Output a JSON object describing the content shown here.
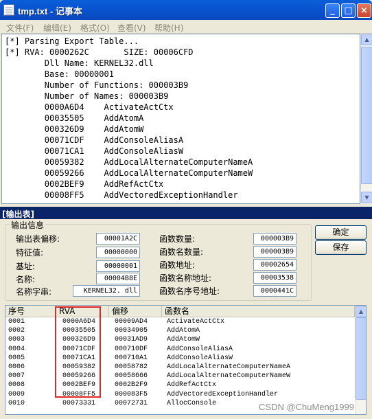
{
  "notepad": {
    "title": "tmp.txt - 记事本",
    "menu": [
      "文件(F)",
      "编辑(E)",
      "格式(O)",
      "查看(V)",
      "帮助(H)"
    ],
    "lines": [
      "[*] Parsing Export Table...",
      "[*] RVA: 0000262C       SIZE: 00006CFD",
      "        Dll Name: KERNEL32.dll",
      "        Base: 00000001",
      "        Number of Functions: 000003B9",
      "        Number of Names: 000003B9",
      "        0000A6D4    ActivateActCtx",
      "        00035505    AddAtomA",
      "        000326D9    AddAtomW",
      "        00071CDF    AddConsoleAliasA",
      "        00071CA1    AddConsoleAliasW",
      "        00059382    AddLocalAlternateComputerNameA",
      "        00059266    AddLocalAlternateComputerNameW",
      "        0002BEF9    AddRefActCtx",
      "        00008FF5    AddVectoredExceptionHandler"
    ]
  },
  "output": {
    "title": "[输出表]",
    "group_label": "输出信息",
    "fields_left": [
      {
        "label": "输出表偏移:",
        "value": "00001A2C"
      },
      {
        "label": "特征值:",
        "value": "00000000"
      },
      {
        "label": "基址:",
        "value": "00000001"
      },
      {
        "label": "名称:",
        "value": "00004B8E"
      },
      {
        "label": "名称字串:",
        "value": "KERNEL32. dll"
      }
    ],
    "fields_right": [
      {
        "label": "函数数量:",
        "value": "000003B9"
      },
      {
        "label": "函数名数量:",
        "value": "000003B9"
      },
      {
        "label": "函数地址:",
        "value": "00002654"
      },
      {
        "label": "函数名称地址:",
        "value": "00003538"
      },
      {
        "label": "函数名序号地址:",
        "value": "0000441C"
      }
    ],
    "ok_label": "确定",
    "save_label": "保存",
    "columns": [
      "序号",
      "RVA",
      "偏移",
      "函数名"
    ],
    "rows": [
      [
        "0001",
        "0000A6D4",
        "00009AD4",
        "ActivateActCtx"
      ],
      [
        "0002",
        "00035505",
        "00034905",
        "AddAtomA"
      ],
      [
        "0003",
        "000326D9",
        "00031AD9",
        "AddAtomW"
      ],
      [
        "0004",
        "00071CDF",
        "000710DF",
        "AddConsoleAliasA"
      ],
      [
        "0005",
        "00071CA1",
        "000710A1",
        "AddConsoleAliasW"
      ],
      [
        "0006",
        "00059382",
        "00058782",
        "AddLocalAlternateComputerNameA"
      ],
      [
        "0007",
        "00059266",
        "00058666",
        "AddLocalAlternateComputerNameW"
      ],
      [
        "0008",
        "0002BEF9",
        "0002B2F9",
        "AddRefActCtx"
      ],
      [
        "0009",
        "00008FF5",
        "000083F5",
        "AddVectoredExceptionHandler"
      ],
      [
        "0010",
        "00073331",
        "00072731",
        "AllocConsole"
      ]
    ]
  },
  "watermark": "CSDN @ChuMeng1999"
}
